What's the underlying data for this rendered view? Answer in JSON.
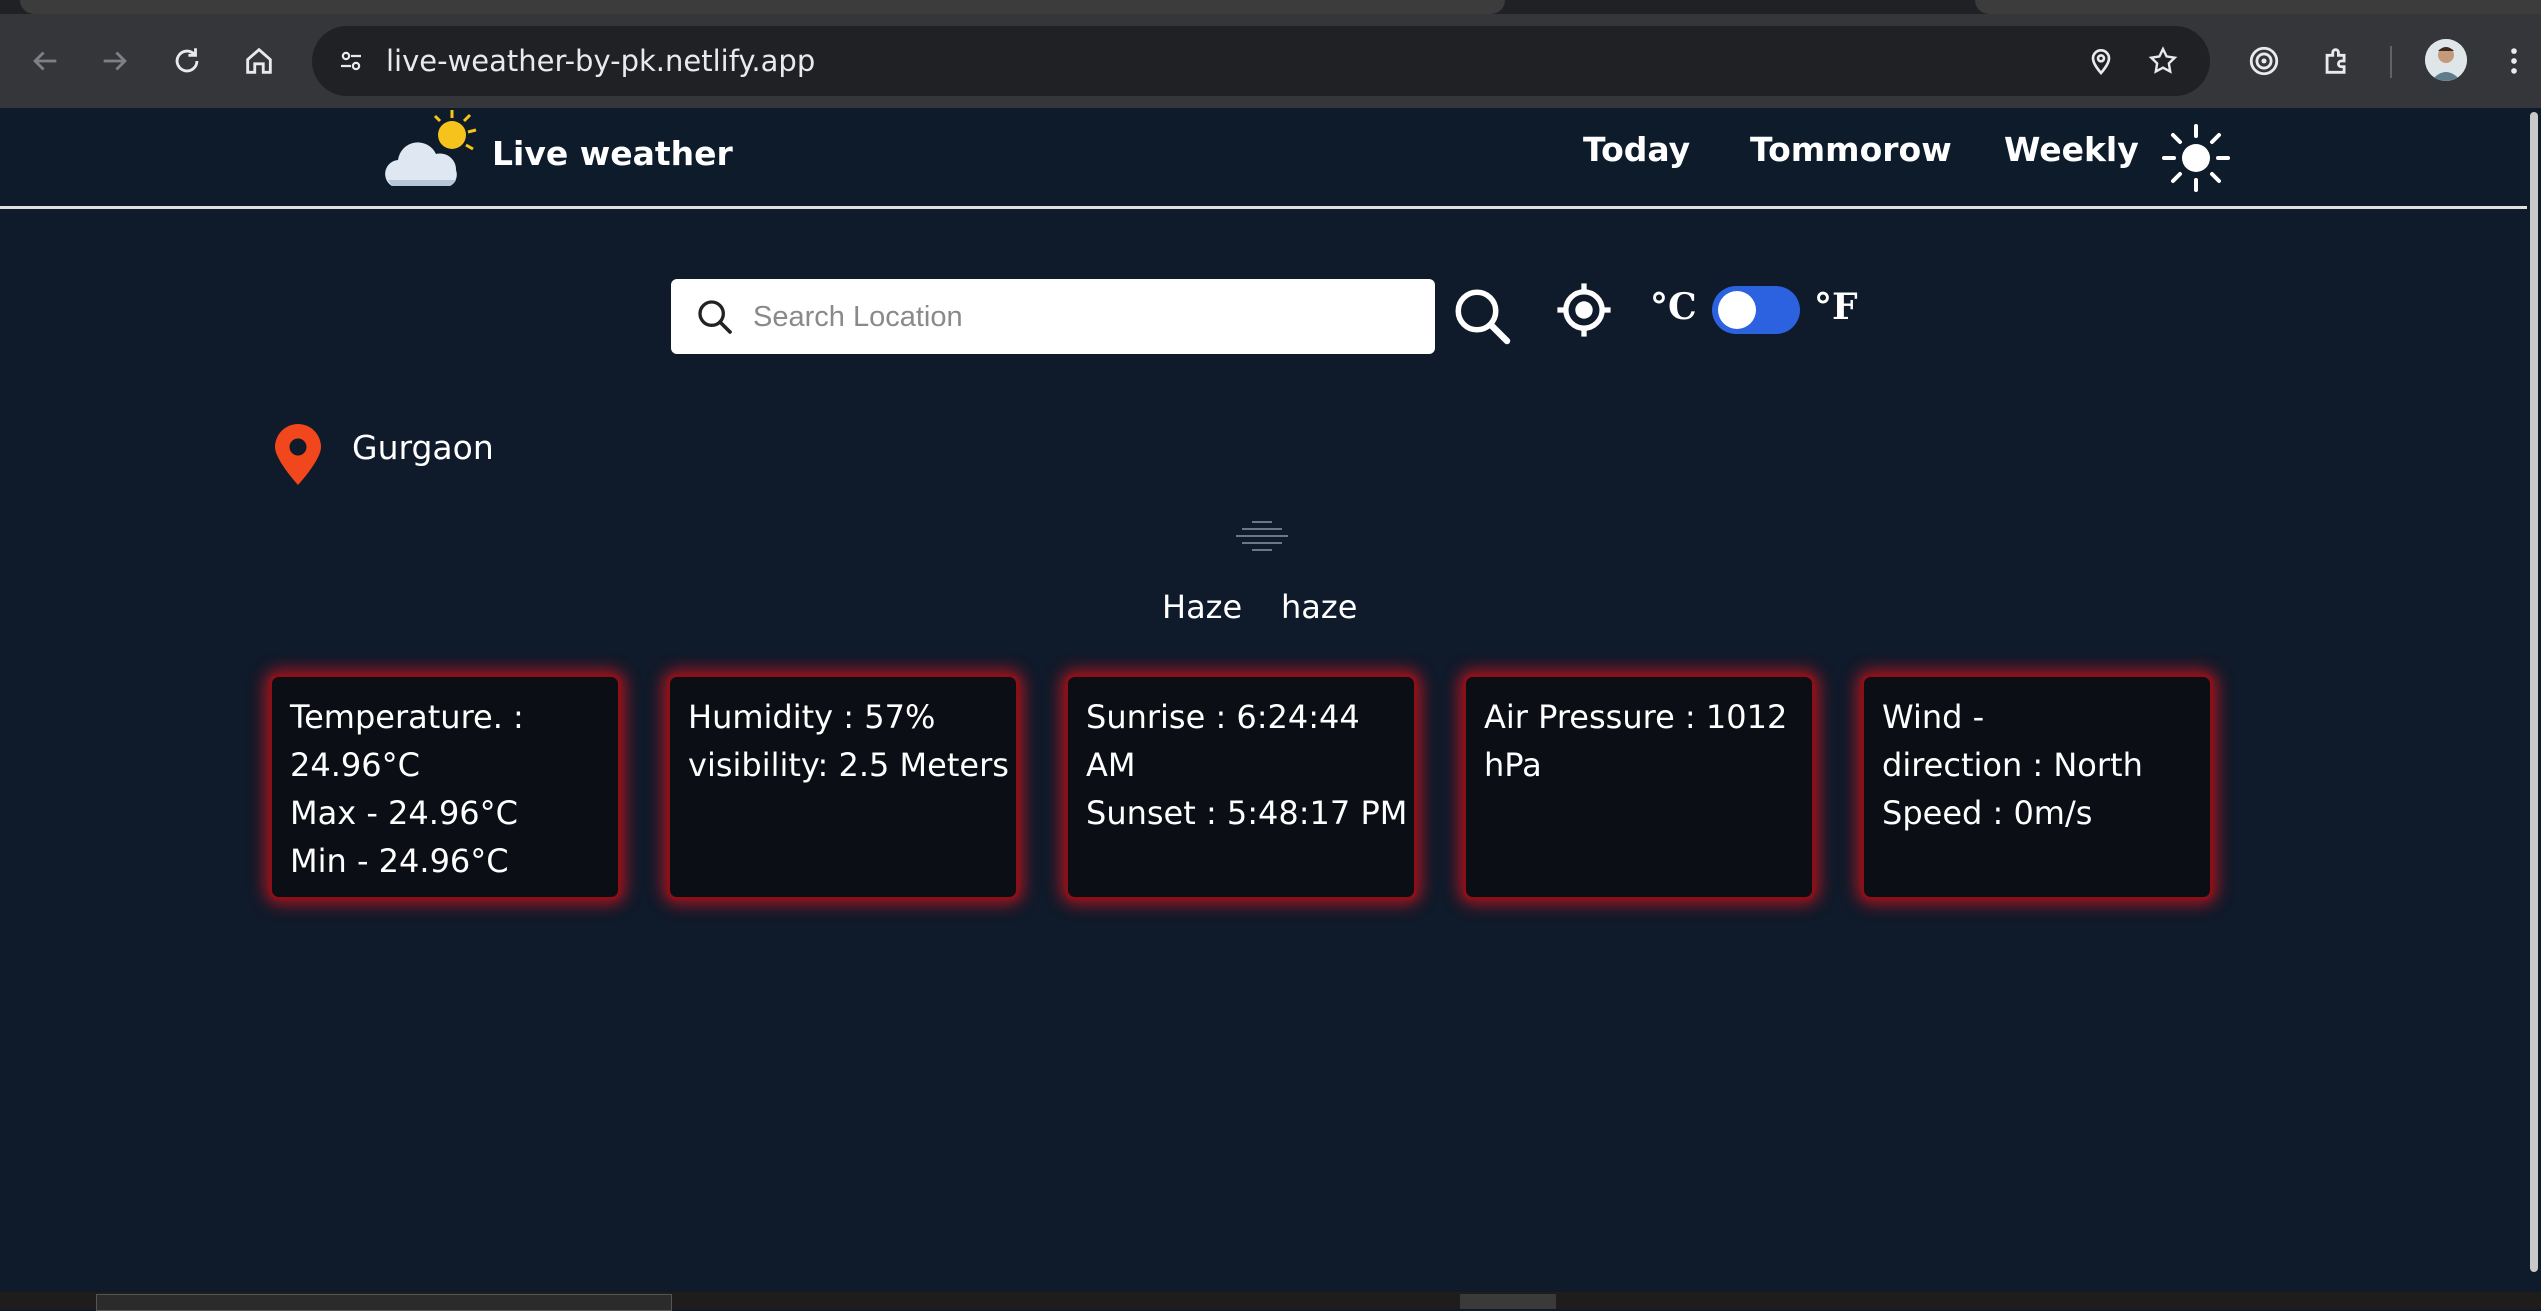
{
  "browser": {
    "url": "live-weather-by-pk.netlify.app"
  },
  "header": {
    "brand": "Live weather",
    "nav": [
      "Today",
      "Tommorow",
      "Weekly"
    ]
  },
  "search": {
    "placeholder": "Search Location",
    "value": ""
  },
  "units": {
    "celsius": "°C",
    "fahrenheit": "°F",
    "toggle_on": false
  },
  "location": {
    "city": "Gurgaon"
  },
  "condition": {
    "main": "Haze",
    "description": "haze"
  },
  "cards": [
    [
      "Temperature. :",
      "24.96°C",
      "Max - 24.96°C",
      "Min - 24.96°C"
    ],
    [
      "Humidity : 57%",
      "visibility: 2.5 Meters"
    ],
    [
      "Sunrise : 6:24:44",
      "AM",
      "Sunset : 5:48:17 PM"
    ],
    [
      "Air Pressure : 1012",
      "hPa"
    ],
    [
      "Wind -",
      "direction : North",
      "Speed : 0m/s"
    ]
  ],
  "colors": {
    "background": "#0f1a2a",
    "card_glow": "#dc141e",
    "toggle": "#2c62e0",
    "pin": "#f2461c"
  }
}
